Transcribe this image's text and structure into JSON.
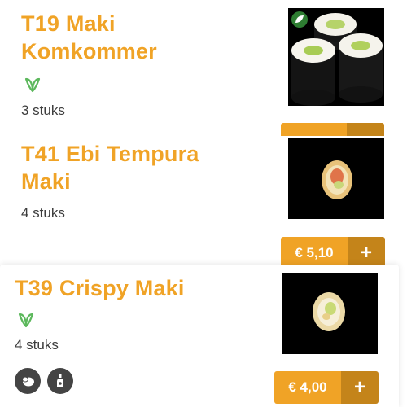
{
  "items": [
    {
      "title_line1": "T19 Maki",
      "title_line2": "Komkommer",
      "vegetarian": true,
      "quantity": "3 stuks",
      "image_icon": "vegetarian-leaf-badge"
    },
    {
      "title_line1": "T41 Ebi Tempura",
      "title_line2": "Maki",
      "vegetarian": false,
      "quantity": "4 stuks",
      "price": "€ 5,10",
      "add_label": "+"
    },
    {
      "title_line1": "T39 Crispy Maki",
      "vegetarian": true,
      "quantity": "4 stuks",
      "price": "€ 4,00",
      "add_label": "+",
      "allergen_icons": [
        "egg-icon",
        "sauce-bottle-icon"
      ]
    }
  ],
  "colors": {
    "accent": "#f0a326",
    "accent_dark": "#c4841a",
    "veg_green": "#5cb85c",
    "text": "#3c3c3c"
  }
}
